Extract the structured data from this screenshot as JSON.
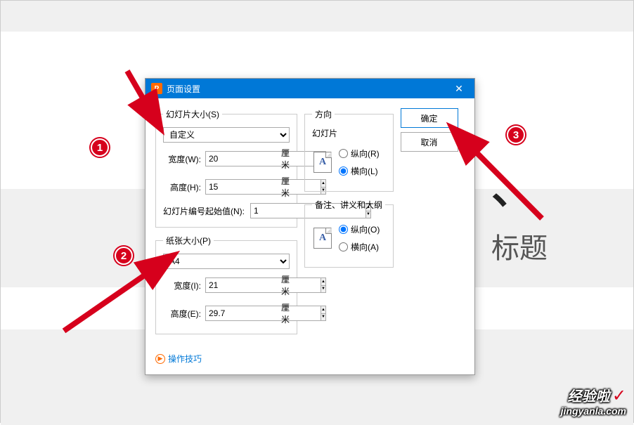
{
  "dialog": {
    "title": "页面设置",
    "app_icon_letter": "P",
    "ok_label": "确定",
    "cancel_label": "取消",
    "help_link": "操作技巧"
  },
  "slide_size": {
    "legend": "幻灯片大小(S)",
    "preset": "自定义",
    "width_label": "宽度(W):",
    "width_value": "20",
    "width_unit": "厘米",
    "height_label": "高度(H):",
    "height_value": "15",
    "height_unit": "厘米",
    "start_num_label": "幻灯片编号起始值(N):",
    "start_num_value": "1"
  },
  "paper_size": {
    "legend": "纸张大小(P)",
    "preset": "A4",
    "width_label": "宽度(I):",
    "width_value": "21",
    "width_unit": "厘米",
    "height_label": "高度(E):",
    "height_value": "29.7",
    "height_unit": "厘米"
  },
  "orientation": {
    "legend": "方向",
    "slide_label": "幻灯片",
    "slide_portrait": "纵向(R)",
    "slide_landscape": "横向(L)",
    "notes_label": "备注、讲义和大纲",
    "notes_portrait": "纵向(O)",
    "notes_landscape": "横向(A)",
    "page_icon_letter": "A"
  },
  "annotations": {
    "marker1": "1",
    "marker2": "2",
    "marker3": "3"
  },
  "background": {
    "partial_text1": "、",
    "partial_text2": "标题"
  },
  "watermark": {
    "line1": "经验啦",
    "check": "✓",
    "line2": "jingyanla.com"
  }
}
